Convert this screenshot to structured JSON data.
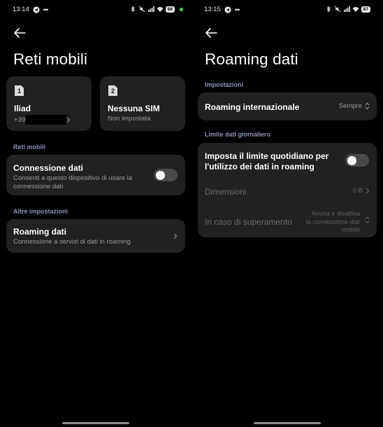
{
  "left": {
    "status": {
      "time": "13:14",
      "battery": "88"
    },
    "title": "Reti mobili",
    "sims": [
      {
        "badge": "1",
        "name": "Iliad",
        "sub": "+39"
      },
      {
        "badge": "2",
        "name": "Nessuna SIM",
        "sub": "Non impostata"
      }
    ],
    "section_reti": "Reti mobili",
    "connessione": {
      "title": "Connessione dati",
      "subtitle_line1": "Consenti a questo dispositivo di usare la",
      "subtitle_line2": "connessione dati",
      "enabled": false
    },
    "section_altre": "Altre impostazioni",
    "roaming": {
      "title": "Roaming dati",
      "subtitle": "Connessione a servizi di dati in roaming"
    }
  },
  "right": {
    "status": {
      "time": "13:15",
      "battery": "87"
    },
    "title": "Roaming dati",
    "section_impostazioni": "Impostazioni",
    "internazionale": {
      "title": "Roaming internazionale",
      "value": "Sempre"
    },
    "section_limite": "Limite dati giornaliero",
    "limite": {
      "title_line1": "Imposta il limite quotidiano per",
      "title_line2": "l'utilizzo dei dati in roaming",
      "enabled": false
    },
    "dimensioni": {
      "title": "Dimensioni",
      "value": "0 B"
    },
    "superamento": {
      "title": "In caso di superamento",
      "value_line1": "Avvisa e disattiva",
      "value_line2": "la connessione dati",
      "value_line3": "mobile"
    }
  }
}
